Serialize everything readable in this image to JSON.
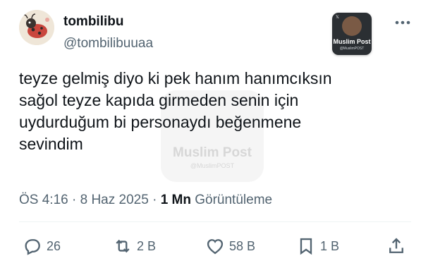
{
  "author": {
    "display_name": "tombilibu",
    "handle": "@tombilibuuaa"
  },
  "watermark": {
    "name": "Muslim Post",
    "handle": "@MuslimPOST"
  },
  "tweet": {
    "text": "teyze gelmiş diyo ki pek hanım hanımcıksın\nsağol teyze kapıda girmeden senin için\nuydurduğum bi personaydı beğenmene\nsevindim"
  },
  "meta": {
    "time": "ÖS 4:16",
    "separator": "·",
    "date": "8 Haz 2025",
    "views_count": "1 Mn",
    "views_label": "Görüntüleme"
  },
  "actions": {
    "reply_count": "26",
    "retweet_count": "2 B",
    "like_count": "58 B",
    "bookmark_count": "1 B"
  },
  "icons": {
    "more": "more-dots-icon",
    "reply": "reply-bubble-icon",
    "retweet": "retweet-icon",
    "like": "heart-icon",
    "bookmark": "bookmark-icon",
    "share": "share-icon"
  },
  "colors": {
    "text_primary": "#0f1419",
    "text_secondary": "#536471",
    "divider": "#eff3f4"
  }
}
